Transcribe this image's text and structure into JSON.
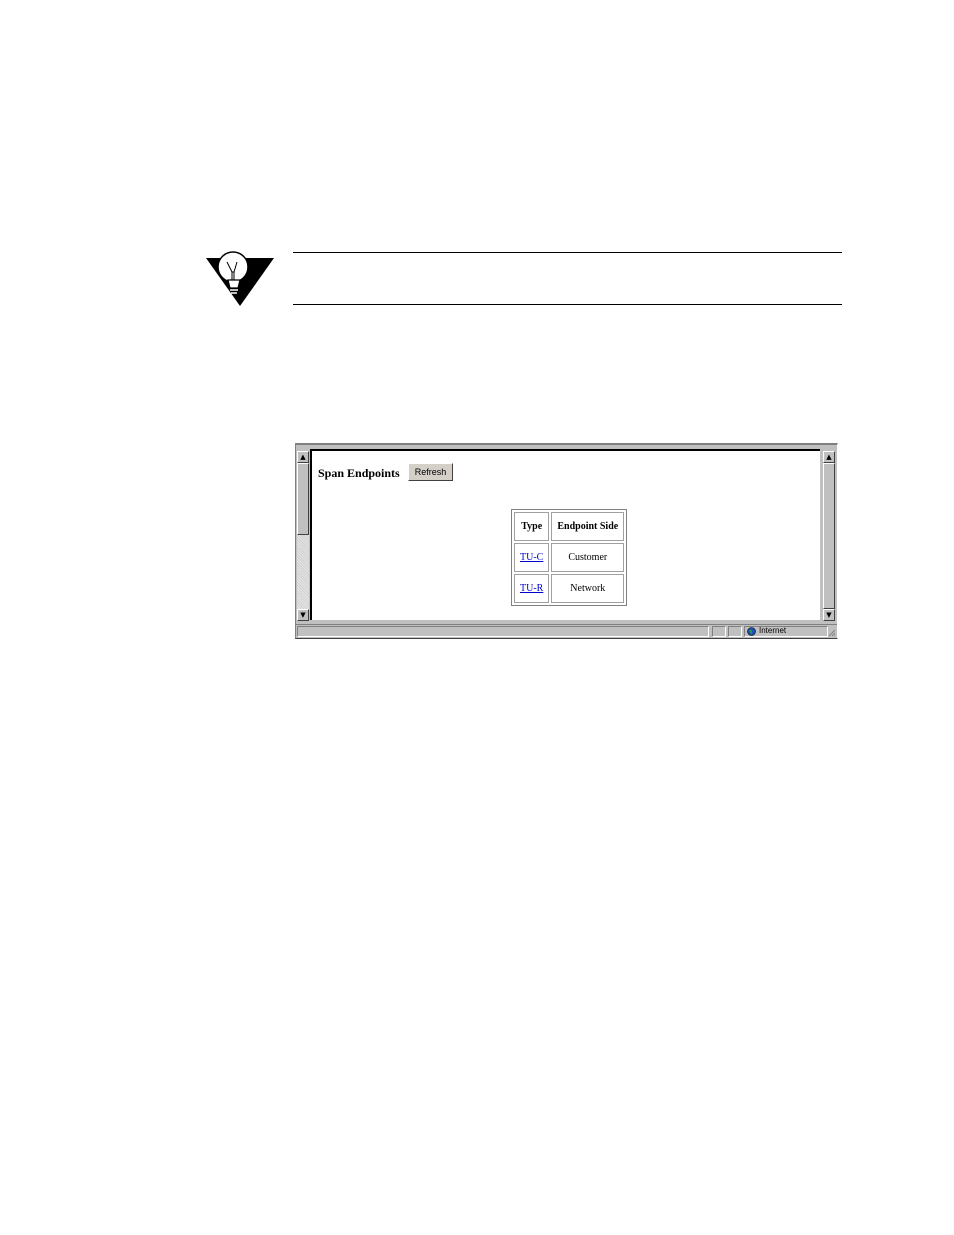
{
  "page": {
    "heading": "Span Endpoints",
    "refresh_label": "Refresh"
  },
  "table": {
    "headers": [
      "Type",
      "Endpoint Side"
    ],
    "rows": [
      {
        "type": "TU-C",
        "side": "Customer"
      },
      {
        "type": "TU-R",
        "side": "Network"
      }
    ]
  },
  "statusbar": {
    "zone": "Internet"
  },
  "colors": {
    "link": "#0000cc",
    "chrome": "#c0c0c0",
    "content_bg": "#ffffff"
  },
  "icons": {
    "note": "lightbulb-note-icon",
    "zone": "internet-globe-icon"
  }
}
